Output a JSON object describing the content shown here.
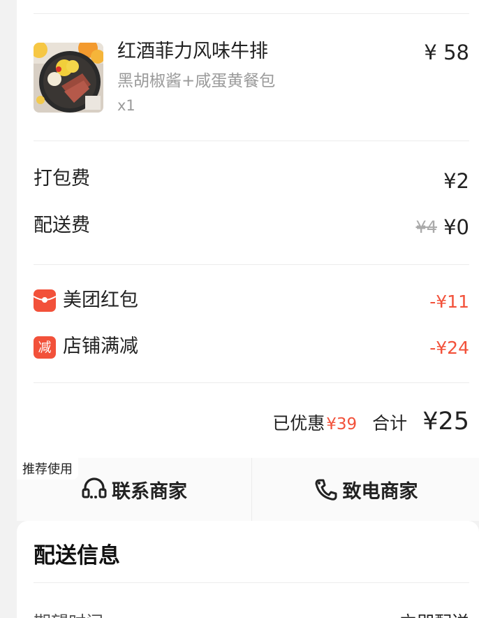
{
  "product": {
    "name": "红酒菲力风味牛排",
    "spec": "黑胡椒酱+咸蛋黄餐包",
    "qty": "x1",
    "price": "¥ 58",
    "thumbnail_icon": "steak-dish-image"
  },
  "fees": {
    "packing": {
      "label": "打包费",
      "value": "¥2"
    },
    "delivery": {
      "label": "配送费",
      "original": "¥4",
      "value": "¥0"
    }
  },
  "discounts": [
    {
      "icon": "red-envelope-icon",
      "label": "美团红包",
      "value": "-¥11"
    },
    {
      "icon": "store-discount-icon",
      "icon_text": "减",
      "label": "店铺满减",
      "value": "-¥24"
    }
  ],
  "summary": {
    "saved_label": "已优惠",
    "saved_value": "¥39",
    "total_label": "合计",
    "total_value": "¥25"
  },
  "contact": {
    "recommend_tag": "推荐使用",
    "chat_label": "联系商家",
    "call_label": "致电商家"
  },
  "delivery_info": {
    "title": "配送信息",
    "expected_time_label": "期望时间",
    "expected_time_value": "立即配送"
  },
  "colors": {
    "accent": "#f2513a",
    "background": "#f2f2f2"
  }
}
